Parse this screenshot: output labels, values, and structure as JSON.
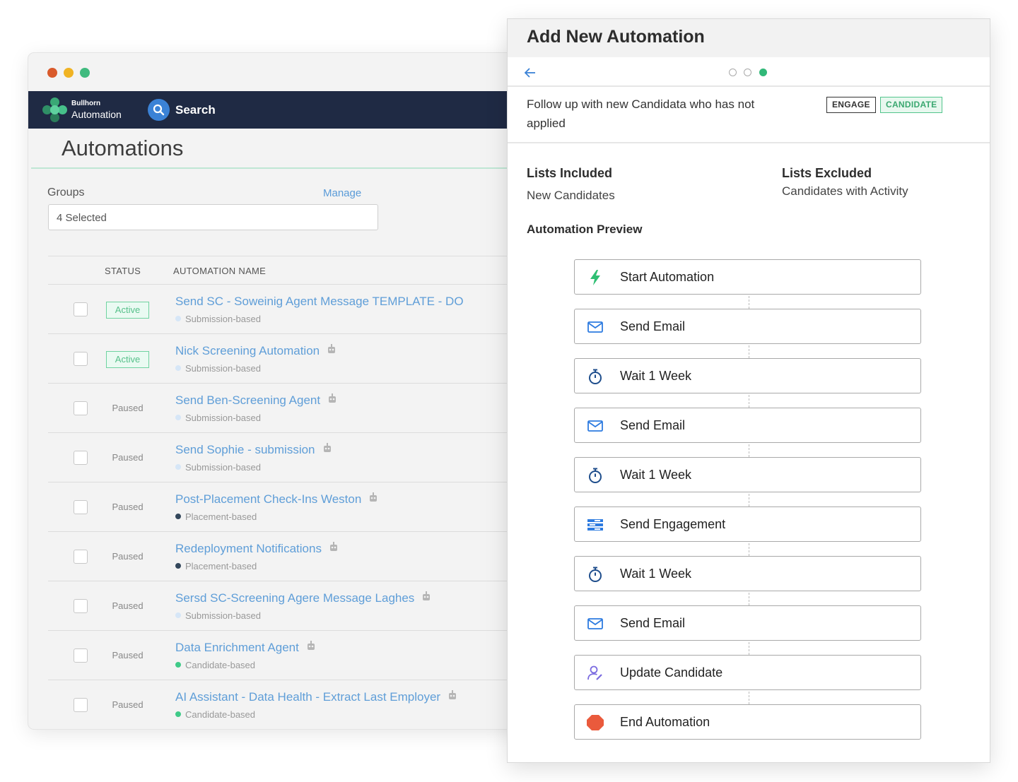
{
  "left_window": {
    "app": {
      "brand_top": "Bullhorn",
      "brand_bottom": "Automation",
      "search_label": "Search"
    },
    "page_title": "Automations",
    "groups": {
      "label": "Groups",
      "manage": "Manage",
      "selected": "4 Selected"
    },
    "table": {
      "headers": {
        "status": "STATUS",
        "name": "AUTOMATION NAME"
      },
      "rows": [
        {
          "status": "Active",
          "name": "Send SC - Soweinig Agent Message TEMPLATE - DO",
          "type": "Submission-based",
          "dot": "#d6e6f7"
        },
        {
          "status": "Active",
          "name": "Nick Screening Automation",
          "type": "Submission-based",
          "dot": "#d6e6f7"
        },
        {
          "status": "Paused",
          "name": "Send Ben-Screening Agent",
          "type": "Submission-based",
          "dot": "#d6e6f7"
        },
        {
          "status": "Paused",
          "name": "Send Sophie - submission",
          "type": "Submission-based",
          "dot": "#d6e6f7"
        },
        {
          "status": "Paused",
          "name": "Post-Placement Check-Ins Weston",
          "type": "Placement-based",
          "dot": "#33475b"
        },
        {
          "status": "Paused",
          "name": "Redeployment Notifications",
          "type": "Placement-based",
          "dot": "#33475b"
        },
        {
          "status": "Paused",
          "name": "Sersd SC-Screening Agere Message Laghes",
          "type": "Submission-based",
          "dot": "#d6e6f7"
        },
        {
          "status": "Paused",
          "name": "Data Enrichment Agent",
          "type": "Candidate-based",
          "dot": "#3fca88"
        },
        {
          "status": "Paused",
          "name": "AI Assistant - Data Health - Extract Last Employer",
          "type": "Candidate-based",
          "dot": "#3fca88"
        }
      ]
    }
  },
  "right_window": {
    "title": "Add New Automation",
    "description": "Follow up with new Candidata who has not applied",
    "tags": {
      "engage": "ENGAGE",
      "candidate": "CANDIDATE"
    },
    "lists_included": {
      "label": "Lists Included",
      "value": "New Candidates"
    },
    "lists_excluded": {
      "label": "Lists Excluded",
      "value": "Candidates with Activity"
    },
    "preview_label": "Automation Preview",
    "steps": [
      {
        "label": "Start Automation",
        "icon": "lightning-icon"
      },
      {
        "label": "Send Email",
        "icon": "envelope-icon"
      },
      {
        "label": "Wait 1 Week",
        "icon": "stopwatch-icon"
      },
      {
        "label": "Send Email",
        "icon": "envelope-icon"
      },
      {
        "label": "Wait 1 Week",
        "icon": "stopwatch-icon"
      },
      {
        "label": "Send Engagement",
        "icon": "engagement-icon"
      },
      {
        "label": "Wait 1 Week",
        "icon": "stopwatch-icon"
      },
      {
        "label": "Send Email",
        "icon": "envelope-icon"
      },
      {
        "label": "Update Candidate",
        "icon": "user-edit-icon"
      },
      {
        "label": "End Automation",
        "icon": "stop-hexagon-icon"
      }
    ]
  }
}
